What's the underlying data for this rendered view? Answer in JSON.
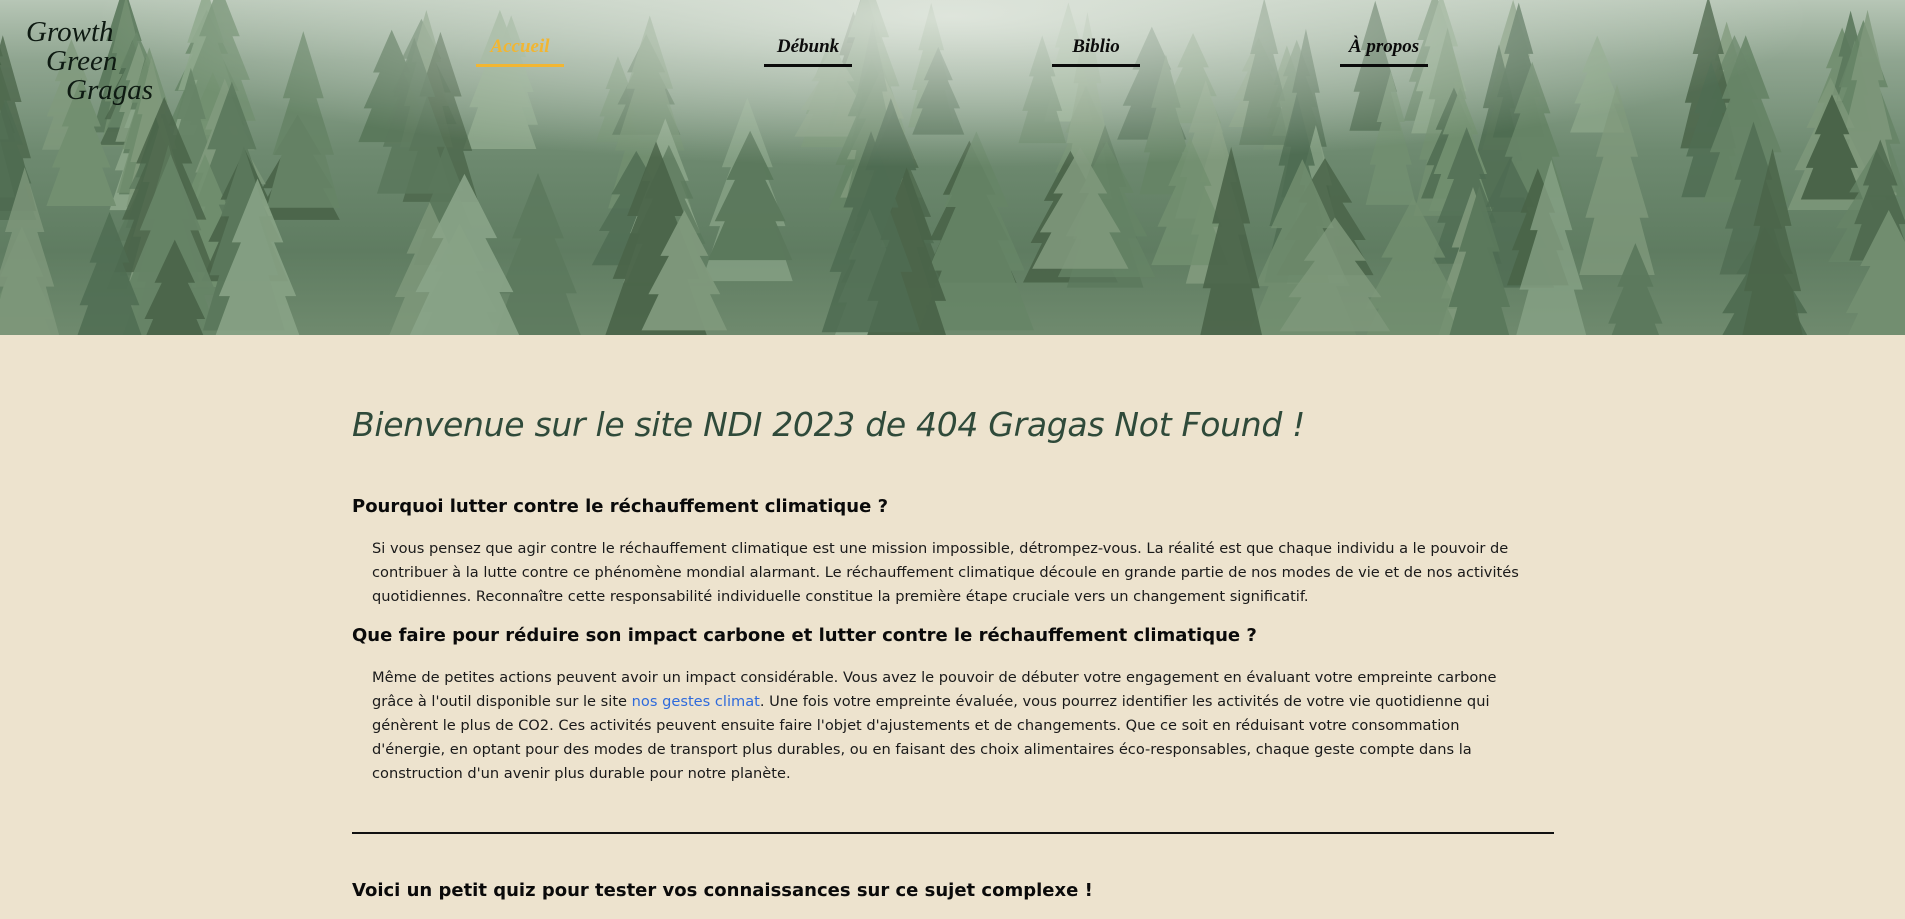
{
  "logo": {
    "line1": "Growth",
    "line2": "Green",
    "line3": "Gragas"
  },
  "nav": {
    "items": [
      {
        "label": "Accueil",
        "active": true
      },
      {
        "label": "Débunk",
        "active": false
      },
      {
        "label": "Biblio",
        "active": false
      },
      {
        "label": "À propos",
        "active": false
      }
    ]
  },
  "colors": {
    "accent": "#f2b632",
    "background": "#ede3ce",
    "title": "#2f4a3a",
    "link": "#2f6bdc"
  },
  "main": {
    "title": "Bienvenue sur le site NDI 2023 de 404 Gragas Not Found !",
    "section1": {
      "heading": "Pourquoi lutter contre le réchauffement climatique ?",
      "text": "Si vous pensez que agir contre le réchauffement climatique est une mission impossible, détrompez-vous. La réalité est que chaque individu a le pouvoir de contribuer à la lutte contre ce phénomène mondial alarmant. Le réchauffement climatique découle en grande partie de nos modes de vie et de nos activités quotidiennes. Reconnaître cette responsabilité individuelle constitue la première étape cruciale vers un changement significatif."
    },
    "section2": {
      "heading": "Que faire pour réduire son impact carbone et lutter contre le réchauffement climatique ?",
      "text_before": "Même de petites actions peuvent avoir un impact considérable. Vous avez le pouvoir de débuter votre engagement en évaluant votre empreinte carbone grâce à l'outil disponible sur le site ",
      "link": "nos gestes climat",
      "text_after": ". Une fois votre empreinte évaluée, vous pourrez identifier les activités de votre vie quotidienne qui génèrent le plus de CO2. Ces activités peuvent ensuite faire l'objet d'ajustements et de changements. Que ce soit en réduisant votre consommation d'énergie, en optant pour des modes de transport plus durables, ou en faisant des choix alimentaires éco-responsables, chaque geste compte dans la construction d'un avenir plus durable pour notre planète."
    },
    "quiz_heading": "Voici un petit quiz pour tester vos connaissances sur ce sujet complexe !"
  }
}
